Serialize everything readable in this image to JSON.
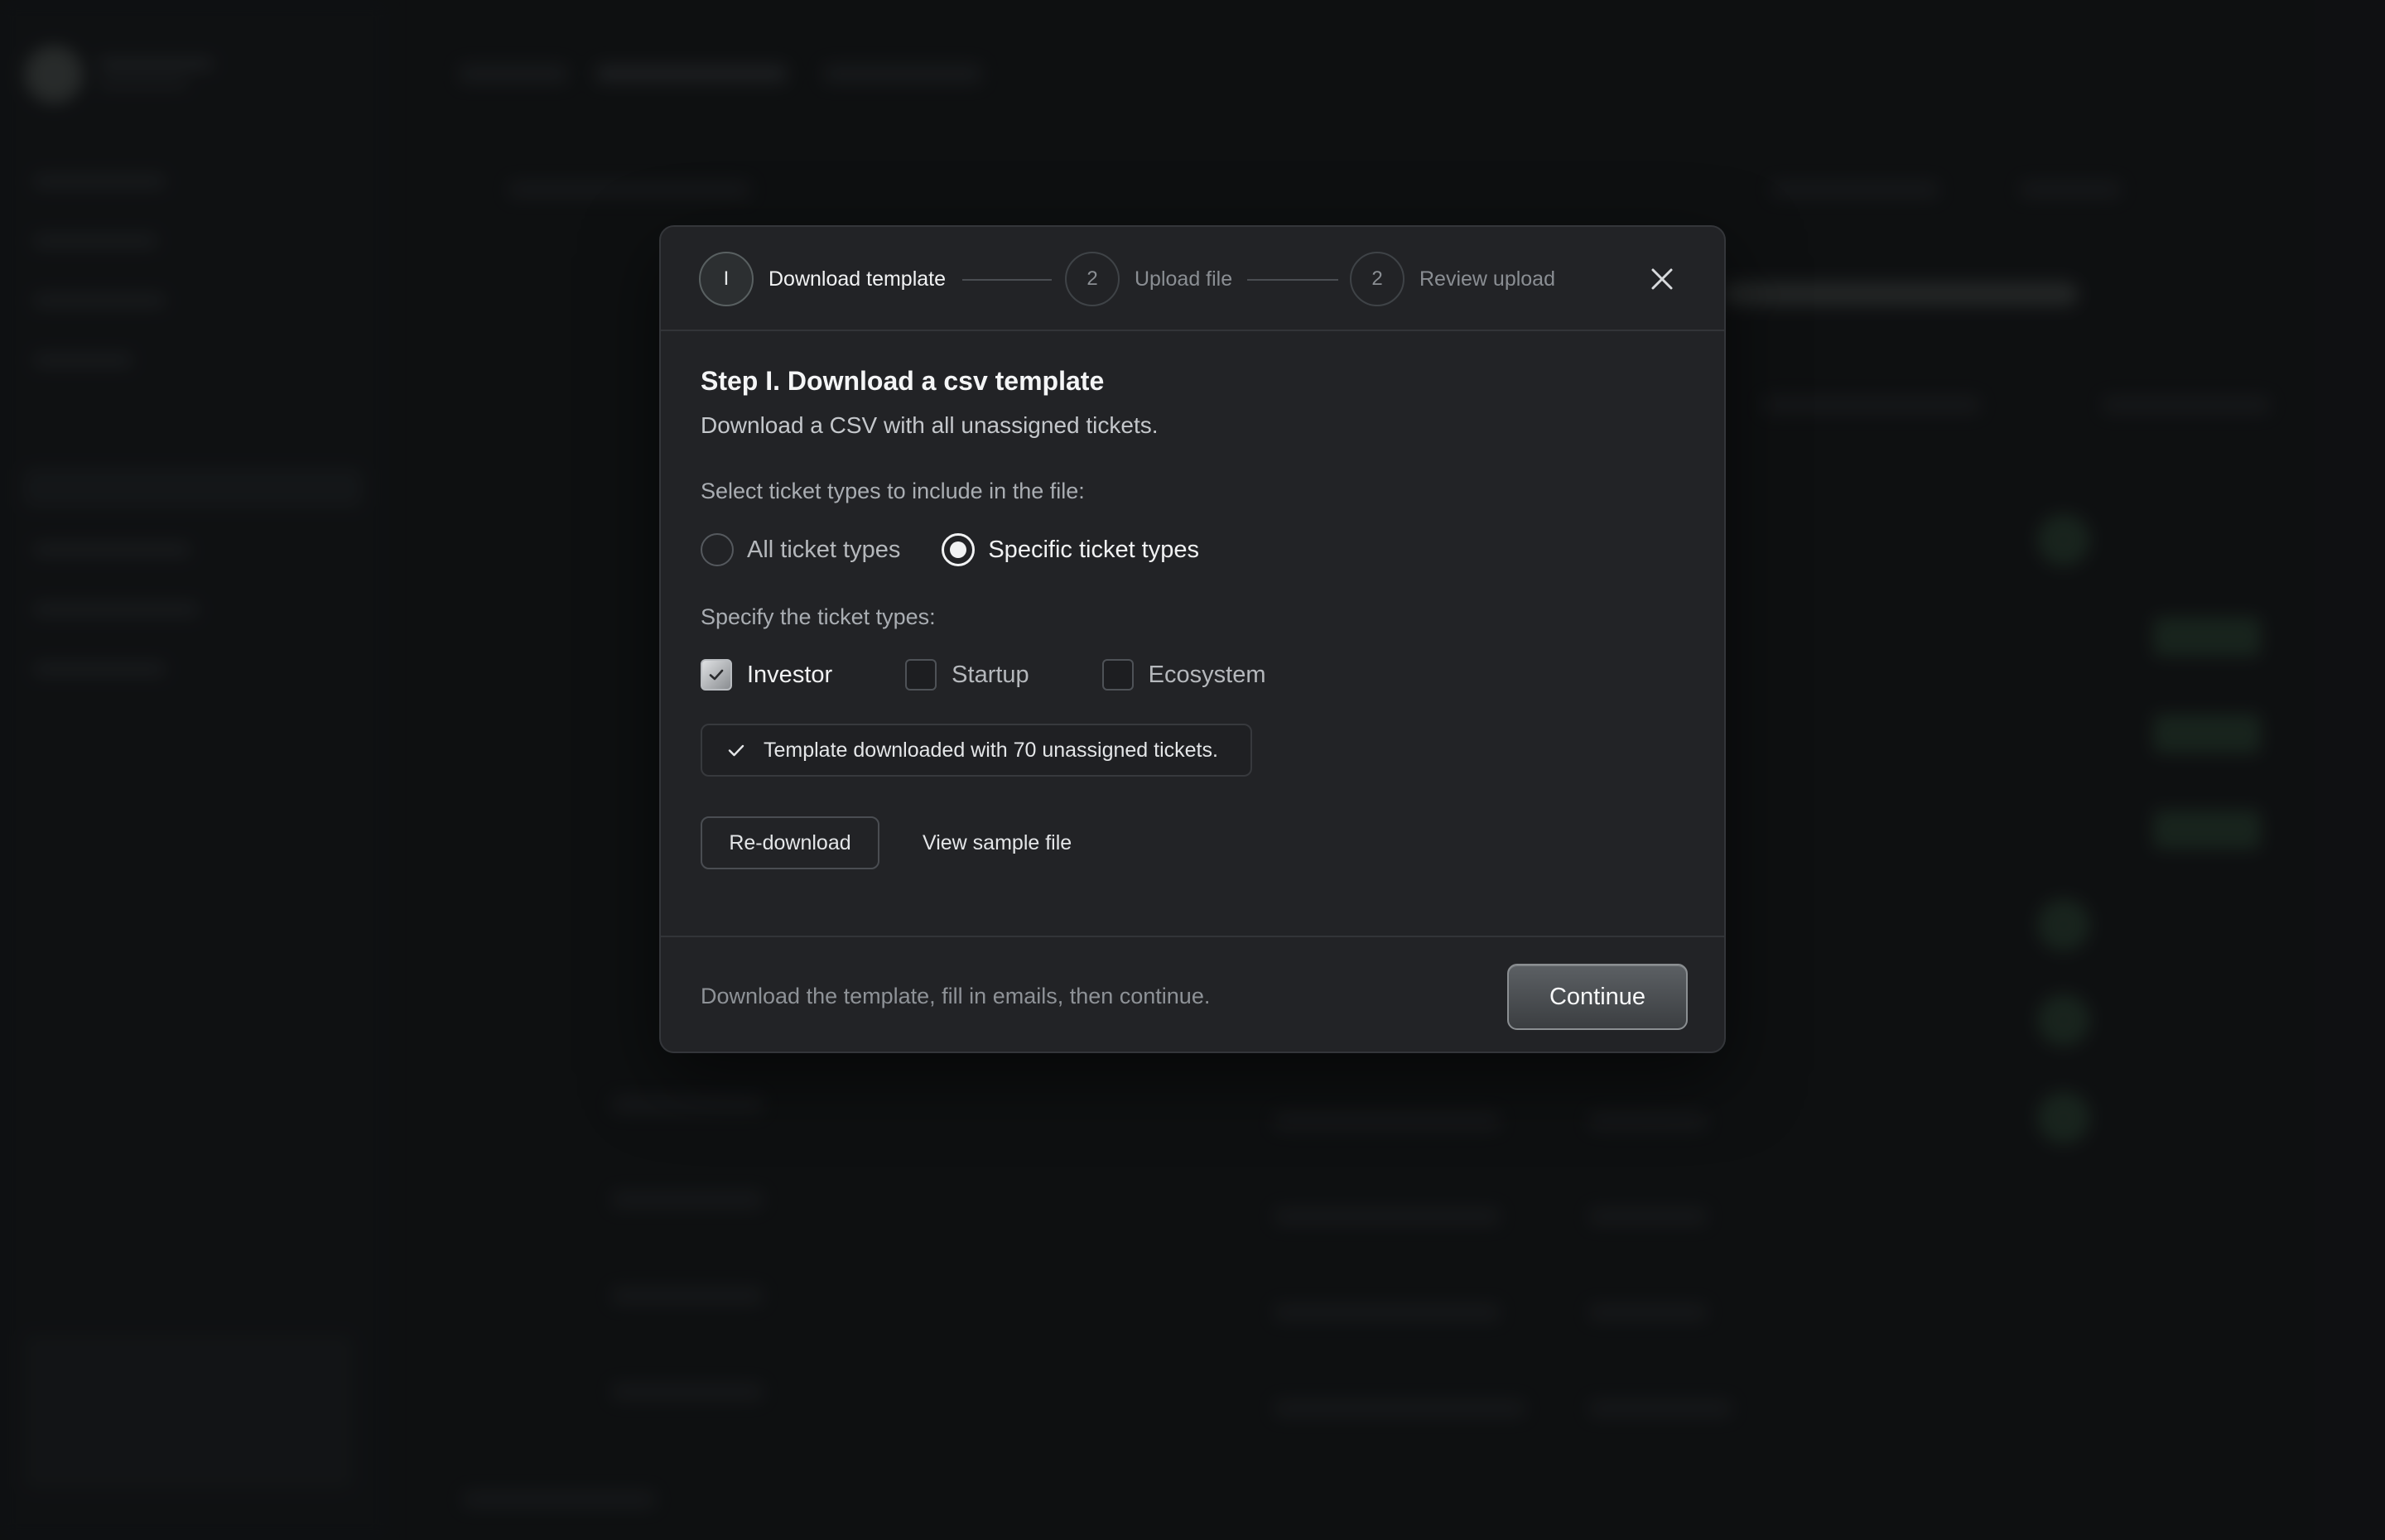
{
  "stepper": {
    "steps": [
      {
        "number": "I",
        "label": "Download template",
        "active": true
      },
      {
        "number": "2",
        "label": "Upload file",
        "active": false
      },
      {
        "number": "2",
        "label": "Review upload",
        "active": false
      }
    ]
  },
  "content": {
    "title": "Step I. Download a csv template",
    "subtitle": "Download a CSV with all unassigned tickets.",
    "select_label": "Select ticket types to include in the file:",
    "radio_options": [
      {
        "label": "All ticket types",
        "selected": false
      },
      {
        "label": "Specific ticket types",
        "selected": true
      }
    ],
    "specify_label": "Specify the ticket types:",
    "checkboxes": [
      {
        "label": "Investor",
        "checked": true
      },
      {
        "label": "Startup",
        "checked": false
      },
      {
        "label": "Ecosystem",
        "checked": false
      }
    ],
    "notice": "Template downloaded with 70 unassigned tickets.",
    "redownload_label": "Re-download",
    "view_sample_label": "View sample file"
  },
  "footer": {
    "hint": "Download the template, fill in emails, then continue.",
    "continue_label": "Continue"
  },
  "icons": {
    "close": "close-icon",
    "check": "check-icon"
  },
  "colors": {
    "modal_bg": "#222326",
    "backdrop": "#121315",
    "text_primary": "#f1f2f3",
    "text_muted": "#8e9297"
  }
}
